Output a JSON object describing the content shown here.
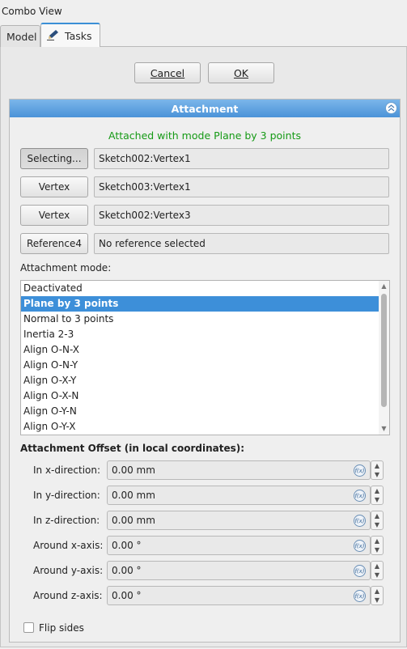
{
  "window": {
    "title": "Combo View"
  },
  "tabs": [
    {
      "label": "Model"
    },
    {
      "label": "Tasks"
    }
  ],
  "dialog_buttons": {
    "cancel": "Cancel",
    "ok": "OK"
  },
  "attachment": {
    "header": "Attachment",
    "status": "Attached with mode Plane by 3 points",
    "references": [
      {
        "button": "Selecting...",
        "value": "Sketch002:Vertex1"
      },
      {
        "button": "Vertex",
        "value": "Sketch003:Vertex1"
      },
      {
        "button": "Vertex",
        "value": "Sketch002:Vertex3"
      },
      {
        "button": "Reference4",
        "value": "No reference selected"
      }
    ],
    "mode_label": "Attachment mode:",
    "modes": [
      "Deactivated",
      "Plane by 3 points",
      "Normal to 3 points",
      "Inertia 2-3",
      "Align O-N-X",
      "Align O-N-Y",
      "Align O-X-Y",
      "Align O-X-N",
      "Align O-Y-N",
      "Align O-Y-X"
    ],
    "selected_mode": "Plane by 3 points",
    "offset_title": "Attachment Offset (in local coordinates):",
    "offsets": [
      {
        "label": "In x-direction:",
        "value": "0.00 mm"
      },
      {
        "label": "In y-direction:",
        "value": "0.00 mm"
      },
      {
        "label": "In z-direction:",
        "value": "0.00 mm"
      },
      {
        "label": "Around x-axis:",
        "value": "0.00 °"
      },
      {
        "label": "Around y-axis:",
        "value": "0.00 °"
      },
      {
        "label": "Around z-axis:",
        "value": "0.00 °"
      }
    ],
    "flip_sides": {
      "label": "Flip sides",
      "checked": false
    }
  },
  "icons": {
    "tasks_tab": "pencil-icon",
    "collapse": "double-chevron-up-icon",
    "expression": "fx-icon"
  },
  "colors": {
    "accent": "#3d8fd9",
    "status_green": "#159a15"
  }
}
